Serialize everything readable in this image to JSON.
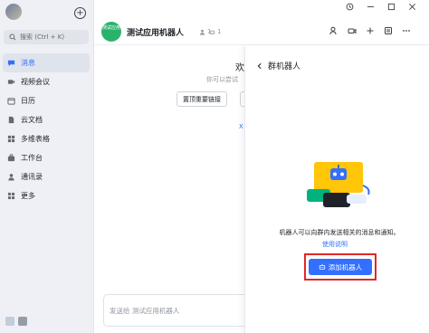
{
  "sidebar": {
    "search_placeholder": "搜索 (Ctrl + K)",
    "items": [
      {
        "label": "消息",
        "icon": "message-icon",
        "active": true
      },
      {
        "label": "视频会议",
        "icon": "video-meeting-icon"
      },
      {
        "label": "日历",
        "icon": "calendar-icon"
      },
      {
        "label": "云文档",
        "icon": "cloud-doc-icon"
      },
      {
        "label": "多维表格",
        "icon": "base-table-icon"
      },
      {
        "label": "工作台",
        "icon": "workplace-icon"
      },
      {
        "label": "通讯录",
        "icon": "contacts-icon"
      },
      {
        "label": "更多",
        "icon": "more-icon"
      }
    ]
  },
  "header": {
    "group_avatar_text": "测试应用",
    "group_name": "测试应用机器人",
    "member_count": "1",
    "bot_count": "1"
  },
  "chat": {
    "welcome": "欢",
    "subtitle": "你可以尝试",
    "pin_button": "置顶重要链接",
    "x_mark": "X",
    "composer_placeholder": "发送给 测试应用机器人"
  },
  "panel": {
    "title": "群机器人",
    "description": "机器人可以向群内发送相关的消息和通知。",
    "help_link": "使用说明",
    "add_button": "添加机器人"
  },
  "colors": {
    "accent": "#3370ff",
    "highlight_frame": "#e02828",
    "group_avatar": "#29b36a"
  }
}
